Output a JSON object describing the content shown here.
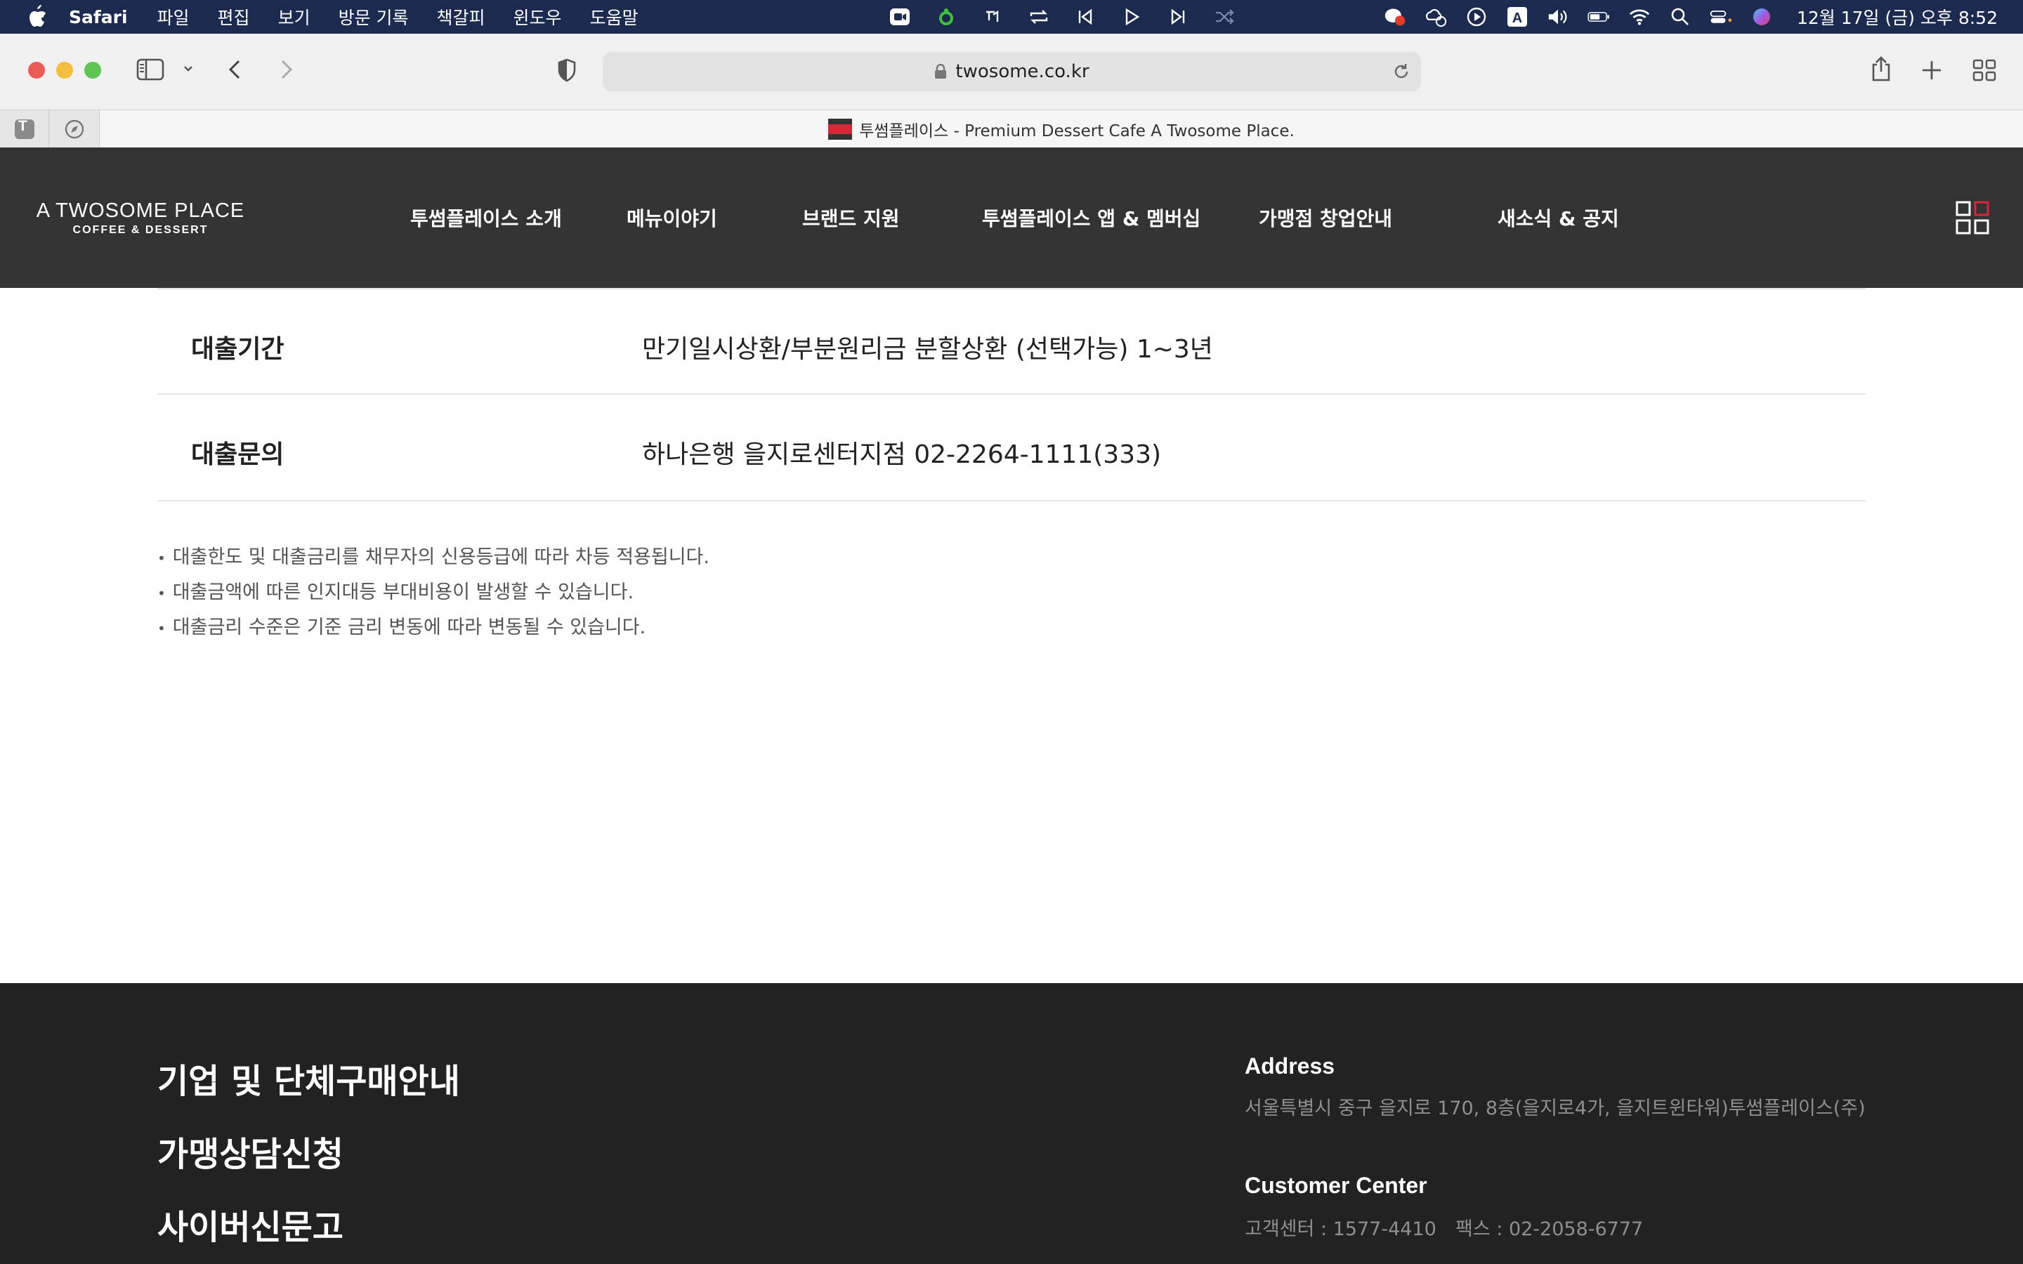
{
  "menubar": {
    "app_name": "Safari",
    "menus": [
      "파일",
      "편집",
      "보기",
      "방문 기록",
      "책갈피",
      "윈도우",
      "도움말"
    ],
    "clock": "12월 17일 (금) 오후 8:52"
  },
  "browser": {
    "url": "twosome.co.kr",
    "tab_title": "투썸플레이스 - Premium Dessert Cafe A Twosome Place.",
    "pinned_tab_letter": "T"
  },
  "site": {
    "logo_line1": "A TWOSOME PLACE",
    "logo_line2": "COFFEE & DESSERT",
    "nav": [
      "투썸플레이스 소개",
      "메뉴이야기",
      "브랜드 지원",
      "투썸플레이스 앱 & 멤버십",
      "가맹점 창업안내",
      "새소식 & 공지"
    ]
  },
  "loan_table": [
    {
      "label": "대출기간",
      "value": "만기일시상환/부분원리금 분할상환 (선택가능) 1~3년"
    },
    {
      "label": "대출문의",
      "value": "하나은행 을지로센터지점 02-2264-1111(333)"
    }
  ],
  "notes": [
    "대출한도 및 대출금리를 채무자의 신용등급에 따라 차등 적용됩니다.",
    "대출금액에 따른 인지대등 부대비용이 발생할 수 있습니다.",
    "대출금리 수준은 기준 금리 변동에 따라 변동될 수 있습니다."
  ],
  "footer": {
    "links": [
      "기업 및 단체구매안내",
      "가맹상담신청",
      "사이버신문고"
    ],
    "address_heading": "Address",
    "address": "서울특별시 중구 을지로 170, 8층(을지로4가, 을지트윈타워)투썸플레이스(주)",
    "customer_heading": "Customer Center",
    "customer_phone": "고객센터 : 1577-4410",
    "fax": "팩스 : 02-2058-6777"
  },
  "colors": {
    "menubar_bg": "#1b2a4e",
    "header_bg": "#333333",
    "footer_bg": "#222222",
    "accent_red": "#d7273a"
  }
}
